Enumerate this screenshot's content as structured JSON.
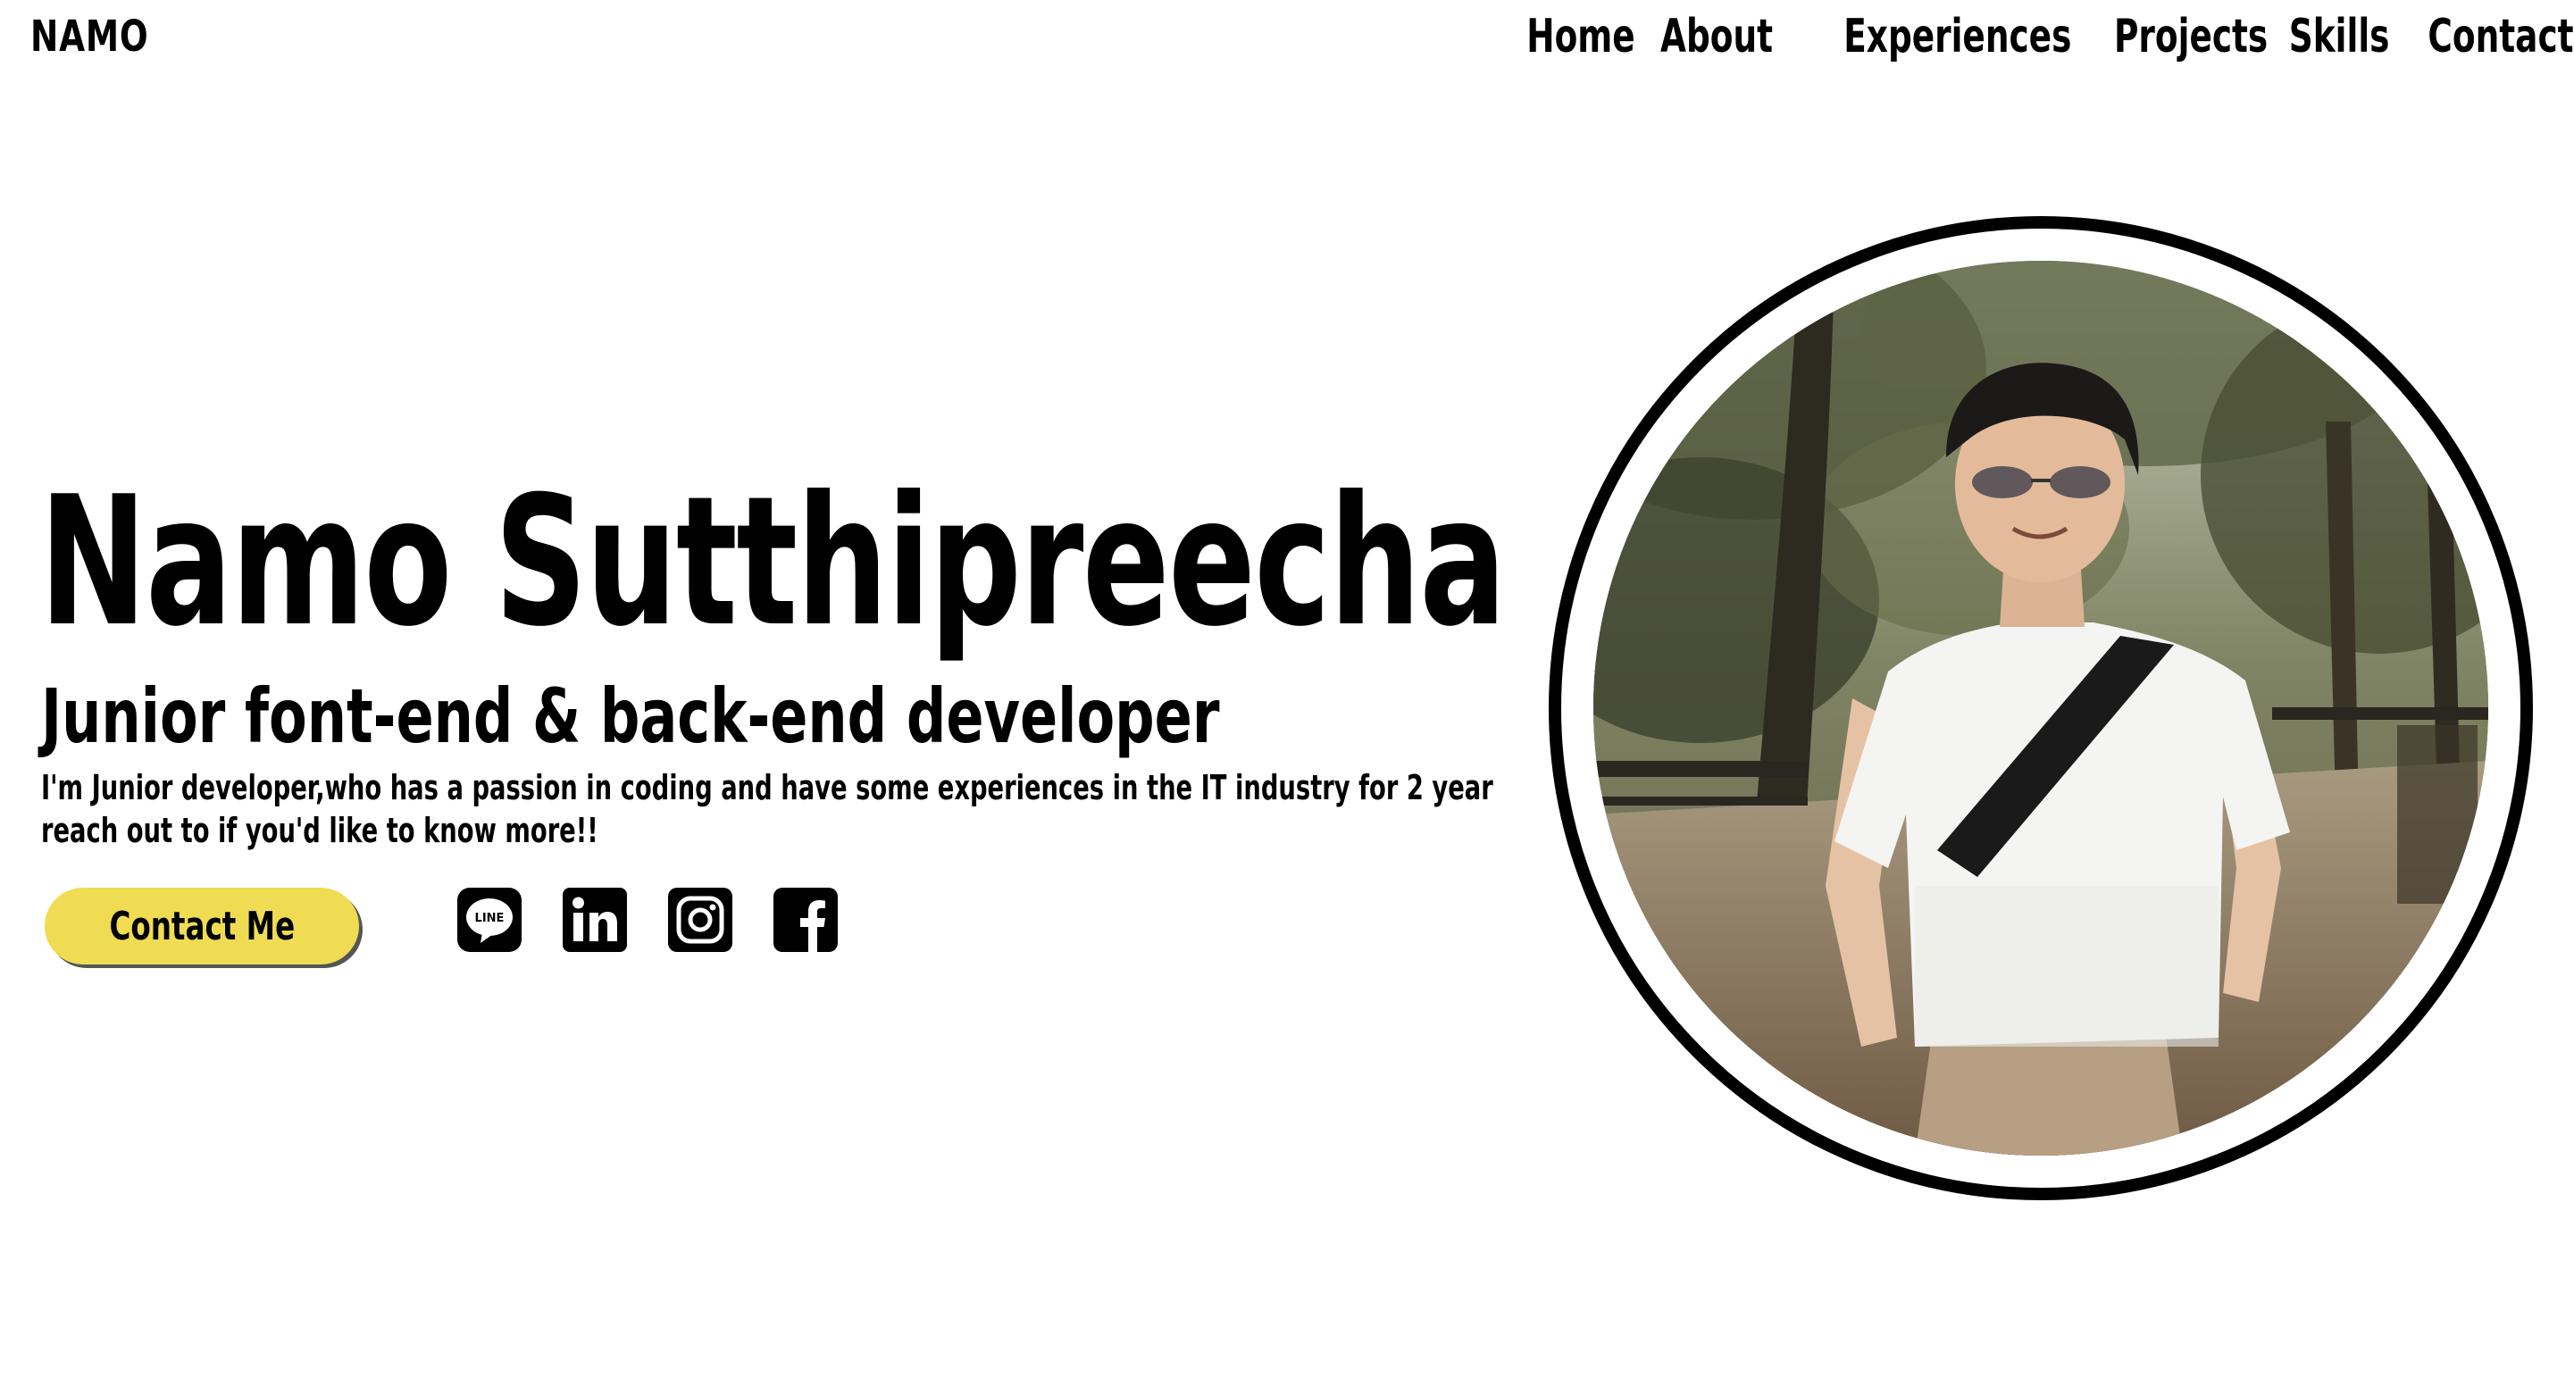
{
  "nav": {
    "logo": "NAMO",
    "links": [
      "Home",
      "About",
      "Experiences",
      "Projects",
      "Skills",
      "Contact"
    ]
  },
  "hero": {
    "name": "Namo Sutthipreecha",
    "role": "Junior font-end & back-end developer",
    "description_lines": [
      "I'm Junior developer,who has a passion in coding and have some experiences in the IT industry for 2 year",
      "reach out to if you'd like to know more!!"
    ],
    "cta_label": "Contact Me"
  },
  "social_icons": [
    "line-icon",
    "linkedin-icon",
    "instagram-icon",
    "facebook-icon"
  ],
  "colors": {
    "accent": "#efdc53",
    "text": "#000000",
    "background": "#ffffff"
  }
}
